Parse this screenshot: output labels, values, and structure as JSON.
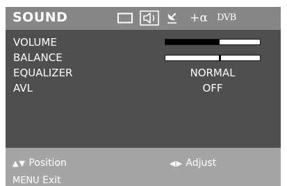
{
  "menu": {
    "title": "SOUND",
    "tabs": [
      {
        "name": "picture",
        "icon": "screen-icon",
        "active": false
      },
      {
        "name": "sound",
        "icon": "speaker-icon",
        "active": true
      },
      {
        "name": "tuning",
        "icon": "satellite-dish-icon",
        "active": false
      },
      {
        "name": "features",
        "icon": "plus-alpha-icon",
        "label": "+α",
        "active": false
      },
      {
        "name": "dvb",
        "icon": "dvb-icon",
        "label": "DVB",
        "active": false
      }
    ]
  },
  "settings": {
    "volume": {
      "label": "VOLUME",
      "level": 0.57
    },
    "balance": {
      "label": "BALANCE",
      "position": 0.57
    },
    "equalizer": {
      "label": "EQUALIZER",
      "value": "NORMAL"
    },
    "avl": {
      "label": "AVL",
      "value": "OFF"
    }
  },
  "footer": {
    "position": {
      "keys": "▲▼",
      "label": "Position"
    },
    "adjust": {
      "keys": "◀▶",
      "label": "Adjust"
    },
    "exit": {
      "key": "MENU",
      "label": "Exit"
    }
  },
  "colors": {
    "header_bg": "#878787",
    "body_bg": "#4f4f4f",
    "footer_bg": "#a5a5a5",
    "text": "#ffffff",
    "bar_fill": "#000000"
  }
}
